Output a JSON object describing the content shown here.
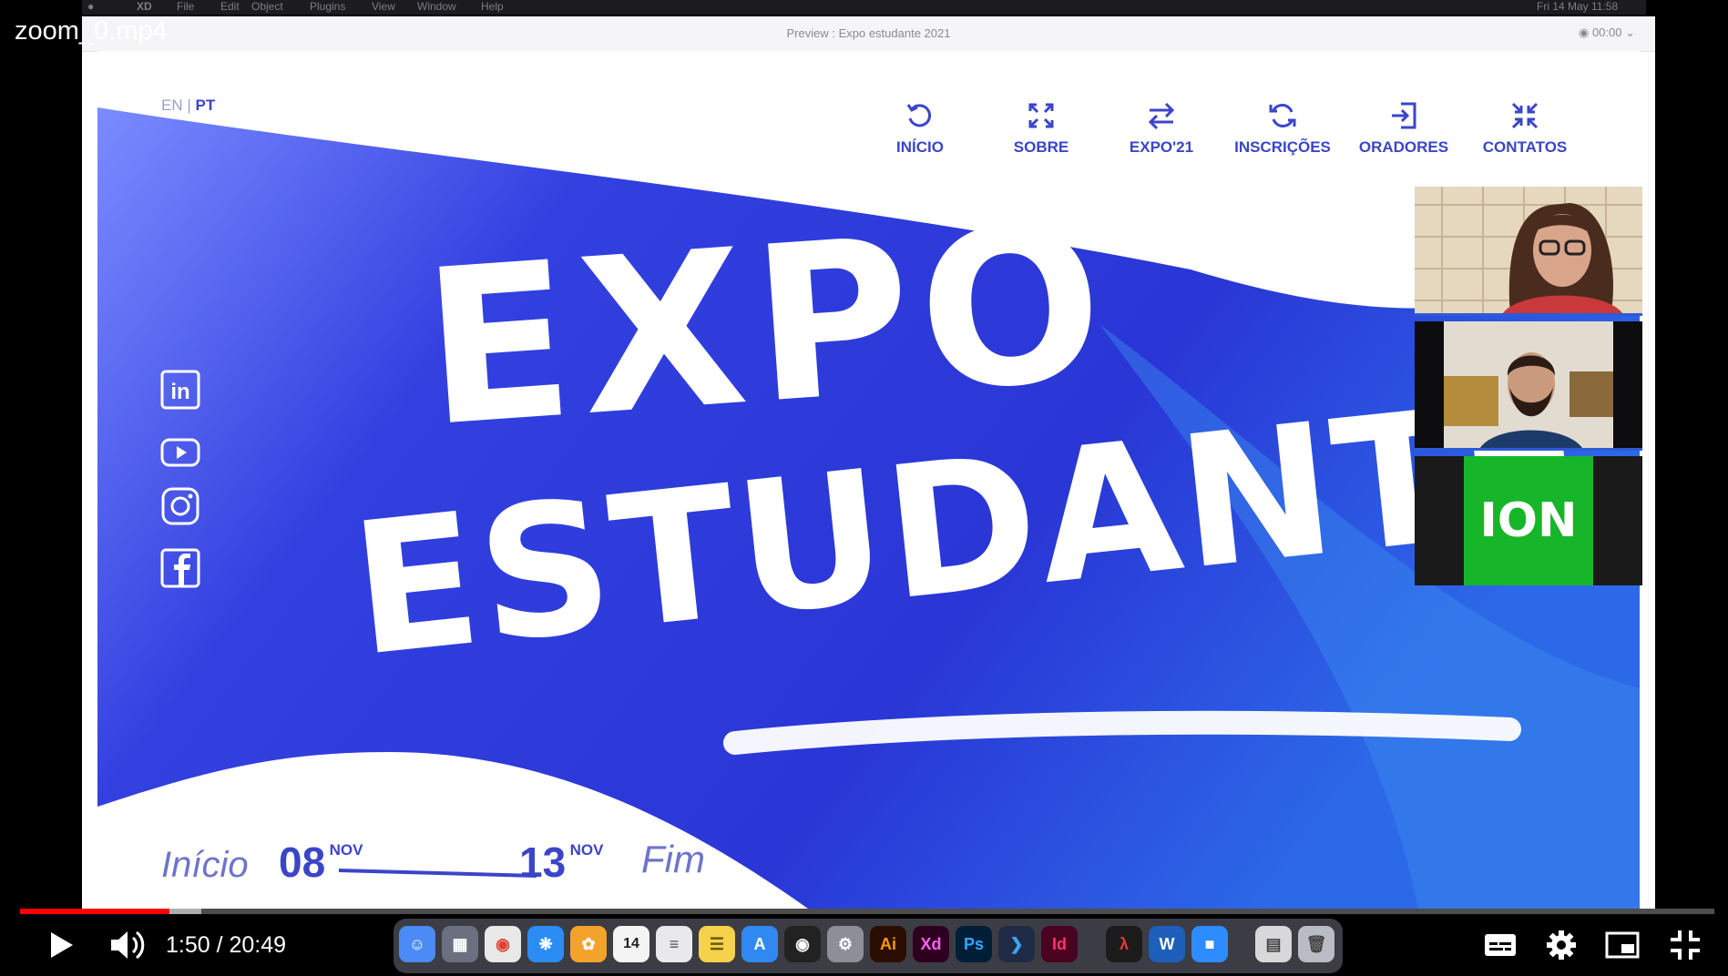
{
  "player": {
    "file_title": "zoom_0.mp4",
    "current_time": "1:50",
    "duration": "20:49",
    "time_display": "1:50 / 20:49",
    "progress_fraction": 0.088,
    "buffered_fraction": 0.107
  },
  "menubar": {
    "app": "XD",
    "items": [
      "File",
      "Edit",
      "Object",
      "Plugins",
      "View",
      "Window",
      "Help"
    ],
    "clock": "Fri 14 May  11:58"
  },
  "window": {
    "title": "Preview : Expo estudante 2021",
    "timer": "00:00"
  },
  "site": {
    "lang_en": "EN",
    "lang_sep": " | ",
    "lang_pt": "PT",
    "nav": [
      {
        "label": "INÍCIO",
        "icon": "refresh-icon"
      },
      {
        "label": "SOBRE",
        "icon": "expand-icon"
      },
      {
        "label": "EXPO'21",
        "icon": "swap-arrows-icon"
      },
      {
        "label": "INSCRIÇÕES",
        "icon": "sync-icon"
      },
      {
        "label": "ORADORES",
        "icon": "login-icon"
      },
      {
        "label": "CONTATOS",
        "icon": "compress-icon"
      }
    ],
    "headline_line1": "EXPO",
    "headline_line2": "ESTUDANTE",
    "social_icons": [
      "linkedin-icon",
      "youtube-icon",
      "instagram-icon",
      "facebook-icon"
    ],
    "dates": {
      "start_label": "Início",
      "start_day": "08",
      "start_month": "NOV",
      "end_day": "13",
      "end_month": "NOV",
      "end_label": "Fim"
    }
  },
  "participants": {
    "third_label": "ION"
  },
  "dock": {
    "calendar_day": "14",
    "apps": [
      "Ai",
      "Xd",
      "Ps",
      "Id",
      "W"
    ]
  },
  "colors": {
    "brand_blue": "#3b45c9",
    "banner_blue": "#2d38d8",
    "progress_red": "#ff0000",
    "ion_green": "#17b529"
  }
}
